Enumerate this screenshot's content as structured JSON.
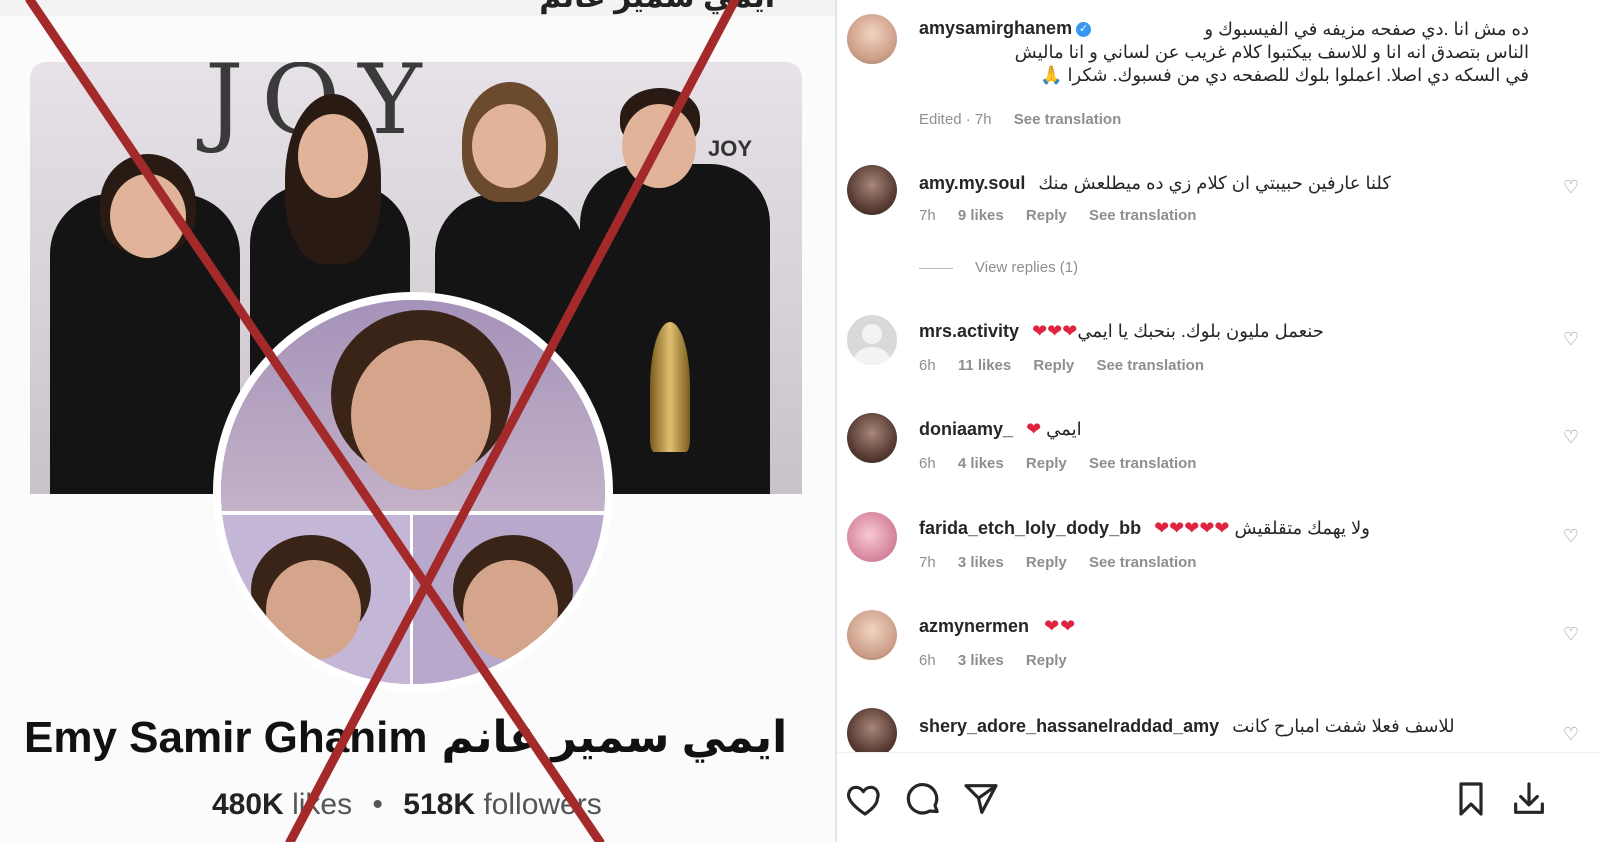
{
  "left_panel": {
    "top_cut_text": "ايمي سمير غانم",
    "cover_brand": "JOY",
    "cover_brand_small": "JOY",
    "page_name_latin": "Emy Samir Ghanim",
    "page_name_arabic": "ايمي سمير غانم",
    "likes_count": "480K",
    "likes_label": "likes",
    "followers_count": "518K",
    "followers_label": "followers",
    "separator": "•",
    "cross_color": "#a3292b"
  },
  "caption": {
    "username": "amysamirghanem",
    "line1": "ده مش انا .دي صفحه مزيفه في الفيسبوك و",
    "line2": "الناس بتصدق انه انا و للاسف بيكتبوا كلام غريب عن لساني و انا ماليش",
    "line3": "في السكه دي اصلا. اعملوا بلوك للصفحه دي من فسبوك. شكرا 🙏",
    "edited": "Edited · 7h",
    "see_translation": "See translation"
  },
  "comments": [
    {
      "username": "amy.my.soul",
      "text": "كلنا عارفين حبيبتي ان كلام زي ده ميطلعش منك",
      "hearts": "",
      "time": "7h",
      "likes": "9 likes",
      "reply": "Reply",
      "see_translation": "See translation",
      "view_replies": "View replies (1)"
    },
    {
      "username": "mrs.activity",
      "text": "حنعمل مليون بلوك. بنحبك يا ايمي",
      "hearts": "❤❤❤",
      "time": "6h",
      "likes": "11 likes",
      "reply": "Reply",
      "see_translation": "See translation"
    },
    {
      "username": "doniaamy_",
      "text": "ايمي",
      "hearts": "❤",
      "time": "6h",
      "likes": "4 likes",
      "reply": "Reply",
      "see_translation": "See translation"
    },
    {
      "username": "farida_etch_loly_dody_bb",
      "text": "ولا يهمك متقلقيش",
      "hearts": "❤❤❤❤❤",
      "time": "7h",
      "likes": "3 likes",
      "reply": "Reply",
      "see_translation": "See translation"
    },
    {
      "username": "azmynermen",
      "text": "",
      "hearts": "❤❤",
      "time": "6h",
      "likes": "3 likes",
      "reply": "Reply"
    },
    {
      "username": "shery_adore_hassanelraddad_amy",
      "text": "للاسف فعلا شفت امبارح كانت",
      "hearts": ""
    }
  ],
  "icons": {
    "like": "heart-outline-icon",
    "comment": "comment-bubble-icon",
    "share": "paper-plane-icon",
    "save": "bookmark-icon",
    "download": "download-icon",
    "comment_like": "heart-outline-icon"
  }
}
